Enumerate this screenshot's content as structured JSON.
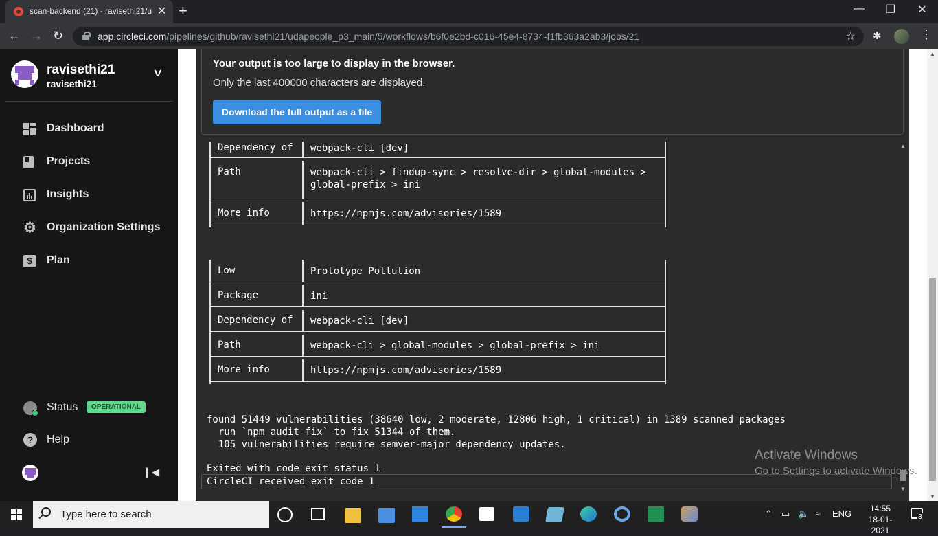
{
  "browser": {
    "tab_title": "scan-backend (21) - ravisethi21/u",
    "tab_close": "✕",
    "new_tab": "+",
    "url_host": "app.circleci.com",
    "url_path": "/pipelines/github/ravisethi21/udapeople_p3_main/5/workflows/b6f0e2bd-c016-45e4-8734-f1fb363a2ab3/jobs/21"
  },
  "sidebar": {
    "org_name": "ravisethi21",
    "org_sub": "ravisethi21",
    "items": [
      {
        "label": "Dashboard"
      },
      {
        "label": "Projects"
      },
      {
        "label": "Insights"
      },
      {
        "label": "Organization Settings"
      },
      {
        "label": "Plan"
      }
    ],
    "status_label": "Status",
    "status_badge": "OPERATIONAL",
    "help_label": "Help"
  },
  "notice": {
    "title": "Your output is too large to display in the browser.",
    "subtitle": "Only the last 400000 characters are displayed.",
    "download_button": "Download the full output as a file"
  },
  "terminal": {
    "table1": [
      {
        "key": "Dependency of",
        "value": "webpack-cli [dev]"
      },
      {
        "key": "Path",
        "value": "webpack-cli > findup-sync > resolve-dir > global-modules >\nglobal-prefix > ini"
      },
      {
        "key": "More info",
        "value": "https://npmjs.com/advisories/1589"
      }
    ],
    "table2": [
      {
        "key": "Low",
        "value": "Prototype Pollution"
      },
      {
        "key": "Package",
        "value": "ini"
      },
      {
        "key": "Dependency of",
        "value": "webpack-cli [dev]"
      },
      {
        "key": "Path",
        "value": "webpack-cli > global-modules > global-prefix > ini"
      },
      {
        "key": "More info",
        "value": "https://npmjs.com/advisories/1589"
      }
    ],
    "summary": "found 51449 vulnerabilities (38640 low, 2 moderate, 12806 high, 1 critical) in 1389 scanned packages\n  run `npm audit fix` to fix 51344 of them.\n  105 vulnerabilities require semver-major dependency updates.",
    "exit_line": "Exited with code exit status 1",
    "received_line": "CircleCI received exit code 1"
  },
  "watermark": {
    "line1": "Activate Windows",
    "line2": "Go to Settings to activate Windows."
  },
  "taskbar": {
    "search_placeholder": "Type here to search",
    "language": "ENG",
    "time": "14:55",
    "date": "18-01-2021",
    "notification_count": "3"
  }
}
